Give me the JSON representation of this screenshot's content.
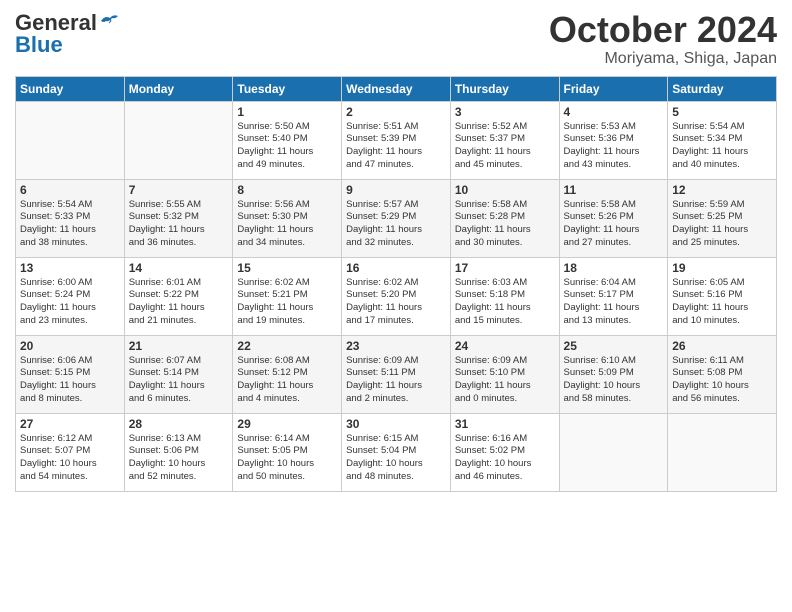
{
  "header": {
    "logo_general": "General",
    "logo_blue": "Blue",
    "month": "October 2024",
    "location": "Moriyama, Shiga, Japan"
  },
  "weekdays": [
    "Sunday",
    "Monday",
    "Tuesday",
    "Wednesday",
    "Thursday",
    "Friday",
    "Saturday"
  ],
  "weeks": [
    [
      {
        "day": "",
        "content": ""
      },
      {
        "day": "",
        "content": ""
      },
      {
        "day": "1",
        "content": "Sunrise: 5:50 AM\nSunset: 5:40 PM\nDaylight: 11 hours\nand 49 minutes."
      },
      {
        "day": "2",
        "content": "Sunrise: 5:51 AM\nSunset: 5:39 PM\nDaylight: 11 hours\nand 47 minutes."
      },
      {
        "day": "3",
        "content": "Sunrise: 5:52 AM\nSunset: 5:37 PM\nDaylight: 11 hours\nand 45 minutes."
      },
      {
        "day": "4",
        "content": "Sunrise: 5:53 AM\nSunset: 5:36 PM\nDaylight: 11 hours\nand 43 minutes."
      },
      {
        "day": "5",
        "content": "Sunrise: 5:54 AM\nSunset: 5:34 PM\nDaylight: 11 hours\nand 40 minutes."
      }
    ],
    [
      {
        "day": "6",
        "content": "Sunrise: 5:54 AM\nSunset: 5:33 PM\nDaylight: 11 hours\nand 38 minutes."
      },
      {
        "day": "7",
        "content": "Sunrise: 5:55 AM\nSunset: 5:32 PM\nDaylight: 11 hours\nand 36 minutes."
      },
      {
        "day": "8",
        "content": "Sunrise: 5:56 AM\nSunset: 5:30 PM\nDaylight: 11 hours\nand 34 minutes."
      },
      {
        "day": "9",
        "content": "Sunrise: 5:57 AM\nSunset: 5:29 PM\nDaylight: 11 hours\nand 32 minutes."
      },
      {
        "day": "10",
        "content": "Sunrise: 5:58 AM\nSunset: 5:28 PM\nDaylight: 11 hours\nand 30 minutes."
      },
      {
        "day": "11",
        "content": "Sunrise: 5:58 AM\nSunset: 5:26 PM\nDaylight: 11 hours\nand 27 minutes."
      },
      {
        "day": "12",
        "content": "Sunrise: 5:59 AM\nSunset: 5:25 PM\nDaylight: 11 hours\nand 25 minutes."
      }
    ],
    [
      {
        "day": "13",
        "content": "Sunrise: 6:00 AM\nSunset: 5:24 PM\nDaylight: 11 hours\nand 23 minutes."
      },
      {
        "day": "14",
        "content": "Sunrise: 6:01 AM\nSunset: 5:22 PM\nDaylight: 11 hours\nand 21 minutes."
      },
      {
        "day": "15",
        "content": "Sunrise: 6:02 AM\nSunset: 5:21 PM\nDaylight: 11 hours\nand 19 minutes."
      },
      {
        "day": "16",
        "content": "Sunrise: 6:02 AM\nSunset: 5:20 PM\nDaylight: 11 hours\nand 17 minutes."
      },
      {
        "day": "17",
        "content": "Sunrise: 6:03 AM\nSunset: 5:18 PM\nDaylight: 11 hours\nand 15 minutes."
      },
      {
        "day": "18",
        "content": "Sunrise: 6:04 AM\nSunset: 5:17 PM\nDaylight: 11 hours\nand 13 minutes."
      },
      {
        "day": "19",
        "content": "Sunrise: 6:05 AM\nSunset: 5:16 PM\nDaylight: 11 hours\nand 10 minutes."
      }
    ],
    [
      {
        "day": "20",
        "content": "Sunrise: 6:06 AM\nSunset: 5:15 PM\nDaylight: 11 hours\nand 8 minutes."
      },
      {
        "day": "21",
        "content": "Sunrise: 6:07 AM\nSunset: 5:14 PM\nDaylight: 11 hours\nand 6 minutes."
      },
      {
        "day": "22",
        "content": "Sunrise: 6:08 AM\nSunset: 5:12 PM\nDaylight: 11 hours\nand 4 minutes."
      },
      {
        "day": "23",
        "content": "Sunrise: 6:09 AM\nSunset: 5:11 PM\nDaylight: 11 hours\nand 2 minutes."
      },
      {
        "day": "24",
        "content": "Sunrise: 6:09 AM\nSunset: 5:10 PM\nDaylight: 11 hours\nand 0 minutes."
      },
      {
        "day": "25",
        "content": "Sunrise: 6:10 AM\nSunset: 5:09 PM\nDaylight: 10 hours\nand 58 minutes."
      },
      {
        "day": "26",
        "content": "Sunrise: 6:11 AM\nSunset: 5:08 PM\nDaylight: 10 hours\nand 56 minutes."
      }
    ],
    [
      {
        "day": "27",
        "content": "Sunrise: 6:12 AM\nSunset: 5:07 PM\nDaylight: 10 hours\nand 54 minutes."
      },
      {
        "day": "28",
        "content": "Sunrise: 6:13 AM\nSunset: 5:06 PM\nDaylight: 10 hours\nand 52 minutes."
      },
      {
        "day": "29",
        "content": "Sunrise: 6:14 AM\nSunset: 5:05 PM\nDaylight: 10 hours\nand 50 minutes."
      },
      {
        "day": "30",
        "content": "Sunrise: 6:15 AM\nSunset: 5:04 PM\nDaylight: 10 hours\nand 48 minutes."
      },
      {
        "day": "31",
        "content": "Sunrise: 6:16 AM\nSunset: 5:02 PM\nDaylight: 10 hours\nand 46 minutes."
      },
      {
        "day": "",
        "content": ""
      },
      {
        "day": "",
        "content": ""
      }
    ]
  ]
}
